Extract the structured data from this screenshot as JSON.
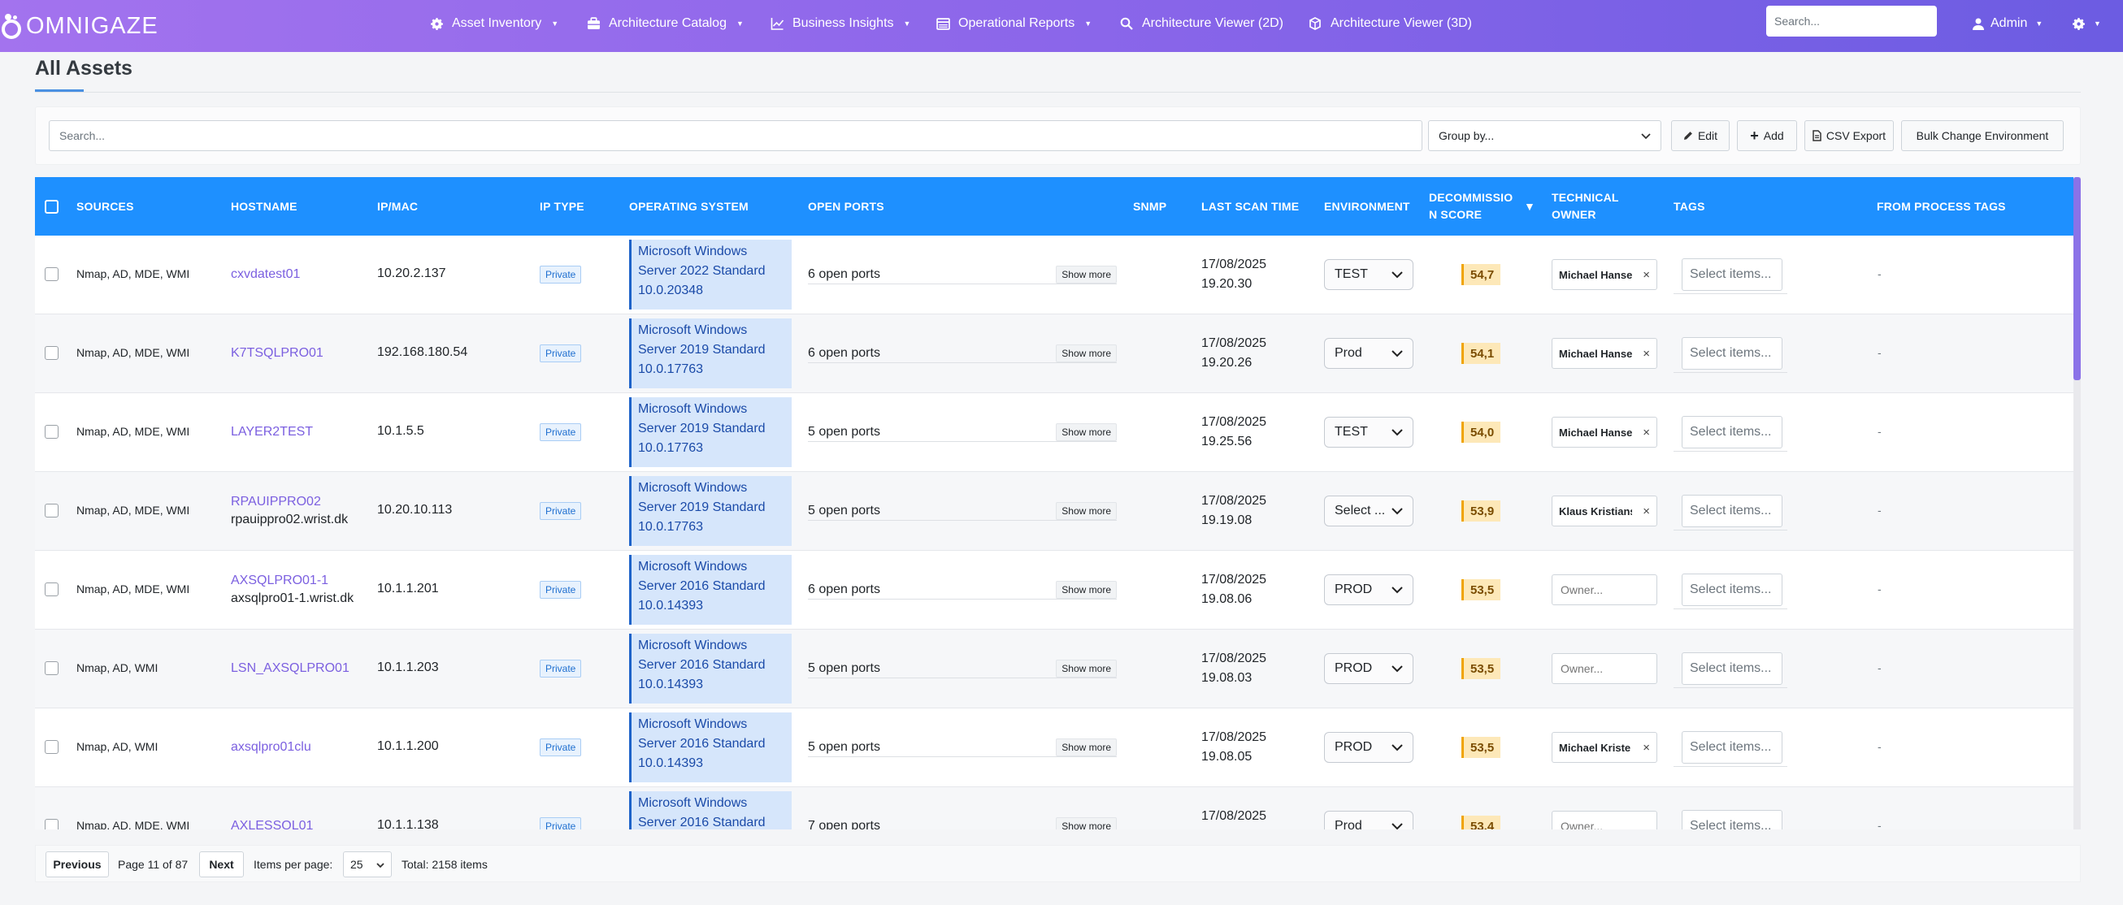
{
  "nav": {
    "brand": "OMNIGAZE",
    "items": [
      {
        "label": "Asset Inventory",
        "icon": "gear-icon",
        "dropdown": true
      },
      {
        "label": "Architecture Catalog",
        "icon": "briefcase-icon",
        "dropdown": true
      },
      {
        "label": "Business Insights",
        "icon": "chart-icon",
        "dropdown": true
      },
      {
        "label": "Operational Reports",
        "icon": "report-icon",
        "dropdown": true
      },
      {
        "label": "Architecture Viewer (2D)",
        "icon": "search-icon",
        "dropdown": false
      },
      {
        "label": "Architecture Viewer (3D)",
        "icon": "cube-icon",
        "dropdown": false
      }
    ],
    "search_placeholder": "Search...",
    "user_label": "Admin"
  },
  "page": {
    "title": "All Assets"
  },
  "toolbar": {
    "search_placeholder": "Search...",
    "group_by_label": "Group by...",
    "edit_label": "Edit",
    "add_label": "Add",
    "csv_export_label": "CSV Export",
    "bulk_change_label": "Bulk Change Environment"
  },
  "table": {
    "headers": {
      "sources": "SOURCES",
      "hostname": "HOSTNAME",
      "ip_mac": "IP/MAC",
      "ip_type": "IP TYPE",
      "os": "OPERATING SYSTEM",
      "open_ports": "OPEN PORTS",
      "snmp": "SNMP",
      "last_scan": "LAST SCAN TIME",
      "environment": "ENVIRONMENT",
      "decom_line1": "DECOMMISSIO",
      "decom_line2": "N SCORE",
      "owner_line1": "TECHNICAL",
      "owner_line2": "OWNER",
      "tags": "TAGS",
      "process_tags": "FROM PROCESS TAGS"
    },
    "show_more_label": "Show more",
    "tags_placeholder": "Select items...",
    "owner_placeholder": "Owner...",
    "rows": [
      {
        "sources": "Nmap, AD, MDE, WMI",
        "hostname": "cxvdatest01",
        "fqdn": "",
        "ip": "10.20.2.137",
        "ip_type": "Private",
        "os_line1": "Microsoft Windows",
        "os_line2": "Server 2022 Standard",
        "os_line3": "10.0.20348",
        "ports": "6 open ports",
        "scan_date": "17/08/2025",
        "scan_time": "19.20.30",
        "environment": "TEST",
        "score": "54,7",
        "owner": "Michael Hanse",
        "process_tags": "-"
      },
      {
        "sources": "Nmap, AD, MDE, WMI",
        "hostname": "K7TSQLPRO01",
        "fqdn": "",
        "ip": "192.168.180.54",
        "ip_type": "Private",
        "os_line1": "Microsoft Windows",
        "os_line2": "Server 2019 Standard",
        "os_line3": "10.0.17763",
        "ports": "6 open ports",
        "scan_date": "17/08/2025",
        "scan_time": "19.20.26",
        "environment": "Prod",
        "score": "54,1",
        "owner": "Michael Hanse",
        "process_tags": "-"
      },
      {
        "sources": "Nmap, AD, MDE, WMI",
        "hostname": "LAYER2TEST",
        "fqdn": "",
        "ip": "10.1.5.5",
        "ip_type": "Private",
        "os_line1": "Microsoft Windows",
        "os_line2": "Server 2019 Standard",
        "os_line3": "10.0.17763",
        "ports": "5 open ports",
        "scan_date": "17/08/2025",
        "scan_time": "19.25.56",
        "environment": "TEST",
        "score": "54,0",
        "owner": "Michael Hanse",
        "process_tags": "-"
      },
      {
        "sources": "Nmap, AD, MDE, WMI",
        "hostname": "RPAUIPPRO02",
        "fqdn": "rpauippro02.wrist.dk",
        "ip": "10.20.10.113",
        "ip_type": "Private",
        "os_line1": "Microsoft Windows",
        "os_line2": "Server 2019 Standard",
        "os_line3": "10.0.17763",
        "ports": "5 open ports",
        "scan_date": "17/08/2025",
        "scan_time": "19.19.08",
        "environment": "Select ...",
        "score": "53,9",
        "owner": "Klaus Kristians",
        "process_tags": "-"
      },
      {
        "sources": "Nmap, AD, MDE, WMI",
        "hostname": "AXSQLPRO01-1",
        "fqdn": "axsqlpro01-1.wrist.dk",
        "ip": "10.1.1.201",
        "ip_type": "Private",
        "os_line1": "Microsoft Windows",
        "os_line2": "Server 2016 Standard",
        "os_line3": "10.0.14393",
        "ports": "6 open ports",
        "scan_date": "17/08/2025",
        "scan_time": "19.08.06",
        "environment": "PROD",
        "score": "53,5",
        "owner": "",
        "process_tags": "-"
      },
      {
        "sources": "Nmap, AD, WMI",
        "hostname": "LSN_AXSQLPRO01",
        "fqdn": "",
        "ip": "10.1.1.203",
        "ip_type": "Private",
        "os_line1": "Microsoft Windows",
        "os_line2": "Server 2016 Standard",
        "os_line3": "10.0.14393",
        "ports": "5 open ports",
        "scan_date": "17/08/2025",
        "scan_time": "19.08.03",
        "environment": "PROD",
        "score": "53,5",
        "owner": "",
        "process_tags": "-"
      },
      {
        "sources": "Nmap, AD, WMI",
        "hostname": "axsqlpro01clu",
        "fqdn": "",
        "ip": "10.1.1.200",
        "ip_type": "Private",
        "os_line1": "Microsoft Windows",
        "os_line2": "Server 2016 Standard",
        "os_line3": "10.0.14393",
        "ports": "5 open ports",
        "scan_date": "17/08/2025",
        "scan_time": "19.08.05",
        "environment": "PROD",
        "score": "53,5",
        "owner": "Michael Kriste",
        "process_tags": "-"
      },
      {
        "sources": "Nmap, AD, MDE, WMI",
        "hostname": "AXLESSQL01",
        "fqdn": "",
        "ip": "10.1.1.138",
        "ip_type": "Private",
        "os_line1": "Microsoft Windows",
        "os_line2": "Server 2016 Standard",
        "os_line3": "",
        "ports": "7 open ports",
        "scan_date": "17/08/2025",
        "scan_time": "",
        "environment": "Prod",
        "score": "53,4",
        "owner": "",
        "process_tags": "-"
      }
    ]
  },
  "pagination": {
    "previous_label": "Previous",
    "page_info": "Page 11 of 87",
    "next_label": "Next",
    "items_per_page_label": "Items per page:",
    "items_per_page_value": "25",
    "total_label": "Total: 2158 items"
  },
  "colors": {
    "nav_gradient_start": "#a373ee",
    "nav_gradient_end": "#6c5ce2",
    "table_header": "#1e90ff",
    "hostname_link": "#7b5fe0",
    "score_badge": "#fde8b8"
  }
}
